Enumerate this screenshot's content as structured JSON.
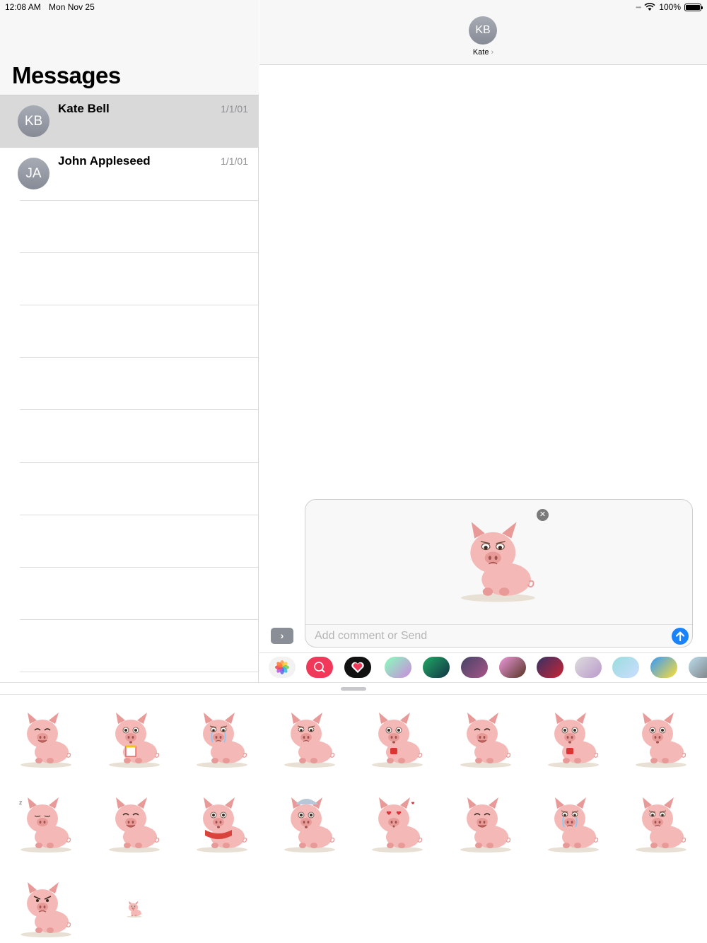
{
  "status_bar": {
    "time": "12:08 AM",
    "date": "Mon Nov 25",
    "battery_percent": "100%",
    "battery_level": 1.0
  },
  "sidebar": {
    "title": "Messages",
    "conversations": [
      {
        "initials": "KB",
        "name": "Kate Bell",
        "date": "1/1/01",
        "selected": true
      },
      {
        "initials": "JA",
        "name": "John Appleseed",
        "date": "1/1/01",
        "selected": false
      }
    ]
  },
  "chat": {
    "contact_initials": "KB",
    "contact_name": "Kate",
    "compose_placeholder": "Add comment or Send",
    "pending_sticker": "sad-pig-sticker"
  },
  "app_strip": [
    {
      "name": "photos-app-icon"
    },
    {
      "name": "images-search-app-icon"
    },
    {
      "name": "digital-touch-app-icon"
    },
    {
      "name": "sticker-pack-app-icon"
    },
    {
      "name": "sticker-pack-app-icon"
    },
    {
      "name": "sticker-pack-app-icon"
    },
    {
      "name": "sticker-pack-app-icon"
    },
    {
      "name": "sticker-pack-app-icon"
    },
    {
      "name": "sticker-pack-app-icon"
    },
    {
      "name": "sticker-pack-app-icon"
    },
    {
      "name": "sticker-pack-app-icon"
    },
    {
      "name": "sticker-pack-app-icon"
    }
  ],
  "sticker_grid": [
    {
      "mood": "winking"
    },
    {
      "mood": "popcorn"
    },
    {
      "mood": "crying"
    },
    {
      "mood": "sad"
    },
    {
      "mood": "coffee-shocked"
    },
    {
      "mood": "dancing-hearts"
    },
    {
      "mood": "coffee-wink"
    },
    {
      "mood": "surprised"
    },
    {
      "mood": "sleeping"
    },
    {
      "mood": "thumbs-up"
    },
    {
      "mood": "sick-scarf"
    },
    {
      "mood": "cold-nightcap"
    },
    {
      "mood": "in-love"
    },
    {
      "mood": "happy"
    },
    {
      "mood": "sobbing"
    },
    {
      "mood": "hopeful"
    },
    {
      "mood": "angry"
    },
    {
      "mood": "small-pig"
    }
  ],
  "colors": {
    "pig_body": "#f4b9b6",
    "pig_shade": "#e89a98",
    "send_blue": "#1a82fb",
    "avatar_gray": "#8e929c"
  }
}
